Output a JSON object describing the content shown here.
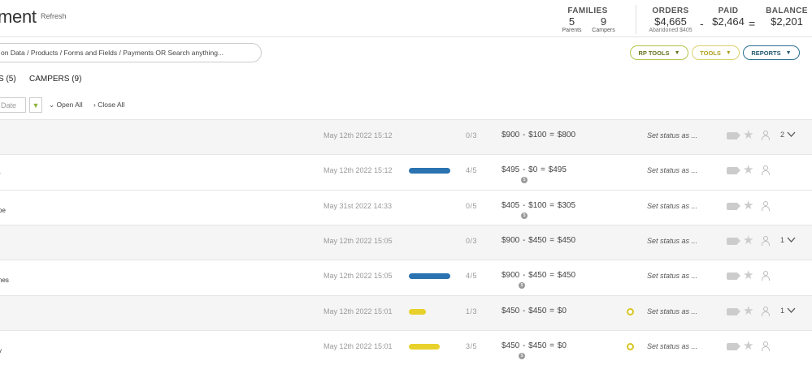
{
  "header": {
    "title": "ment",
    "refresh": "Refresh"
  },
  "stats": {
    "families_label": "FAMILIES",
    "parents_count": "5",
    "parents_label": "Parents",
    "campers_count": "9",
    "campers_label": "Campers",
    "orders_label": "ORDERS",
    "orders_value": "$4,665",
    "abandoned_label": "Abandoned",
    "abandoned_value": "$405",
    "minus": "-",
    "paid_label": "PAID",
    "paid_value": "$2,464",
    "equals": "=",
    "balance_label": "BALANCE",
    "balance_value": "$2,201"
  },
  "search": {
    "placeholder": "on Data / Products / Forms and Fields / Payments OR Search anything..."
  },
  "toolbar": {
    "rp_tools": "RP TOOLS",
    "tools": "TOOLS",
    "reports": "REPORTS"
  },
  "tabs": [
    {
      "label": "S (5)"
    },
    {
      "label": "CAMPERS (9)"
    }
  ],
  "filters": {
    "date_placeholder": "Date",
    "open_all": "Open All",
    "close_all": "Close All"
  },
  "colors": {
    "bar_blue": "#2a73b0",
    "bar_yellow": "#e8d12a",
    "rp_tools": "#b5c34a",
    "tools": "#d9d06a",
    "reports": "#2a6f8f"
  },
  "rows": [
    {
      "type": "group",
      "name": "",
      "date": "May 12th 2022 15:12",
      "progress": null,
      "count": "0/3",
      "money": "$900  -  $100  =  $800",
      "set_status": "Set status as ...",
      "expand": "2"
    },
    {
      "type": "camper",
      "name": "r",
      "date": "May 12th 2022 15:12",
      "progress": {
        "fraction": 0.8,
        "color": "blue"
      },
      "count": "4/5",
      "money": "$495  -  $0  =  $495",
      "set_status": "Set status as ...",
      "sub_icon": true
    },
    {
      "type": "camper",
      "name": "pe",
      "date": "May 31st 2022 14:33",
      "progress": null,
      "count": "0/5",
      "money": "$405  -  $100  =  $305",
      "set_status": "Set status as ...",
      "sub_icon": true
    },
    {
      "type": "group",
      "name": "",
      "date": "May 12th 2022 15:05",
      "progress": null,
      "count": "0/3",
      "money": "$900  -  $450  =  $450",
      "set_status": "Set status as ...",
      "expand": "1"
    },
    {
      "type": "camper",
      "name": "nes",
      "date": "May 12th 2022 15:05",
      "progress": {
        "fraction": 0.8,
        "color": "blue"
      },
      "count": "4/5",
      "money": "$900  -  $450  =  $450",
      "set_status": "Set status as ...",
      "sub_icon": true
    },
    {
      "type": "group",
      "name": "",
      "date": "May 12th 2022 15:01",
      "progress": {
        "fraction": 0.33,
        "color": "yellow"
      },
      "count": "1/3",
      "money": "$450  -  $450  =  $0",
      "set_status": "Set status as ...",
      "expand": "1",
      "gear": true
    },
    {
      "type": "camper",
      "name": "v",
      "date": "May 12th 2022 15:01",
      "progress": {
        "fraction": 0.6,
        "color": "yellow"
      },
      "count": "3/5",
      "money": "$450  -  $450  =  $0",
      "set_status": "Set status as ...",
      "sub_icon": true,
      "gear": true
    }
  ]
}
